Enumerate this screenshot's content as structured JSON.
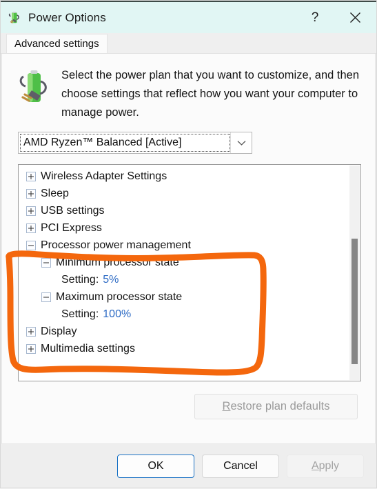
{
  "window": {
    "title": "Power Options",
    "icon": "power-plan-battery-icon",
    "help_label": "?",
    "close_label": "✕"
  },
  "tabs": [
    {
      "label": "Advanced settings",
      "active": true
    }
  ],
  "description": {
    "icon": "power-plan-battery-icon",
    "text": "Select the power plan that you want to customize, and then choose settings that reflect how you want your computer to manage power."
  },
  "plan_selector": {
    "name": "power-plan-combobox",
    "value": "AMD Ryzen™ Balanced [Active]",
    "arrow_icon": "chevron-down-icon"
  },
  "tree": {
    "items": [
      {
        "label": "Wireless Adapter Settings",
        "level": 0,
        "state": "collapsed",
        "type": "category"
      },
      {
        "label": "Sleep",
        "level": 0,
        "state": "collapsed",
        "type": "category"
      },
      {
        "label": "USB settings",
        "level": 0,
        "state": "collapsed",
        "type": "category"
      },
      {
        "label": "PCI Express",
        "level": 0,
        "state": "collapsed",
        "type": "category"
      },
      {
        "label": "Processor power management",
        "level": 0,
        "state": "expanded",
        "type": "category"
      },
      {
        "label": "Minimum processor state",
        "level": 1,
        "state": "expanded",
        "type": "category"
      },
      {
        "label": "Setting:",
        "value": "5%",
        "level": 2,
        "type": "setting"
      },
      {
        "label": "Maximum processor state",
        "level": 1,
        "state": "expanded",
        "type": "category"
      },
      {
        "label": "Setting:",
        "value": "100%",
        "level": 2,
        "type": "setting"
      },
      {
        "label": "Display",
        "level": 0,
        "state": "collapsed",
        "type": "category"
      },
      {
        "label": "Multimedia settings",
        "level": 0,
        "state": "collapsed",
        "type": "category"
      }
    ],
    "scrollbar": {
      "name": "tree-vertical-scrollbar"
    }
  },
  "restore_button": {
    "label": "Restore plan defaults",
    "access_key": "R",
    "enabled": false
  },
  "footer_buttons": [
    {
      "name": "ok-button",
      "label": "OK",
      "enabled": true,
      "default": true,
      "access_key": ""
    },
    {
      "name": "cancel-button",
      "label": "Cancel",
      "enabled": true,
      "default": false,
      "access_key": ""
    },
    {
      "name": "apply-button",
      "label": "Apply",
      "enabled": false,
      "default": false,
      "access_key": "A"
    }
  ],
  "annotation": {
    "type": "hand-drawn-rectangle",
    "color": "#f4670d",
    "encloses": "Processor power management section"
  },
  "colors": {
    "titlebar": "#e1f6f4",
    "link_value": "#2c6ac4",
    "annotation_orange": "#f4670d",
    "default_button_border": "#1871c4"
  }
}
